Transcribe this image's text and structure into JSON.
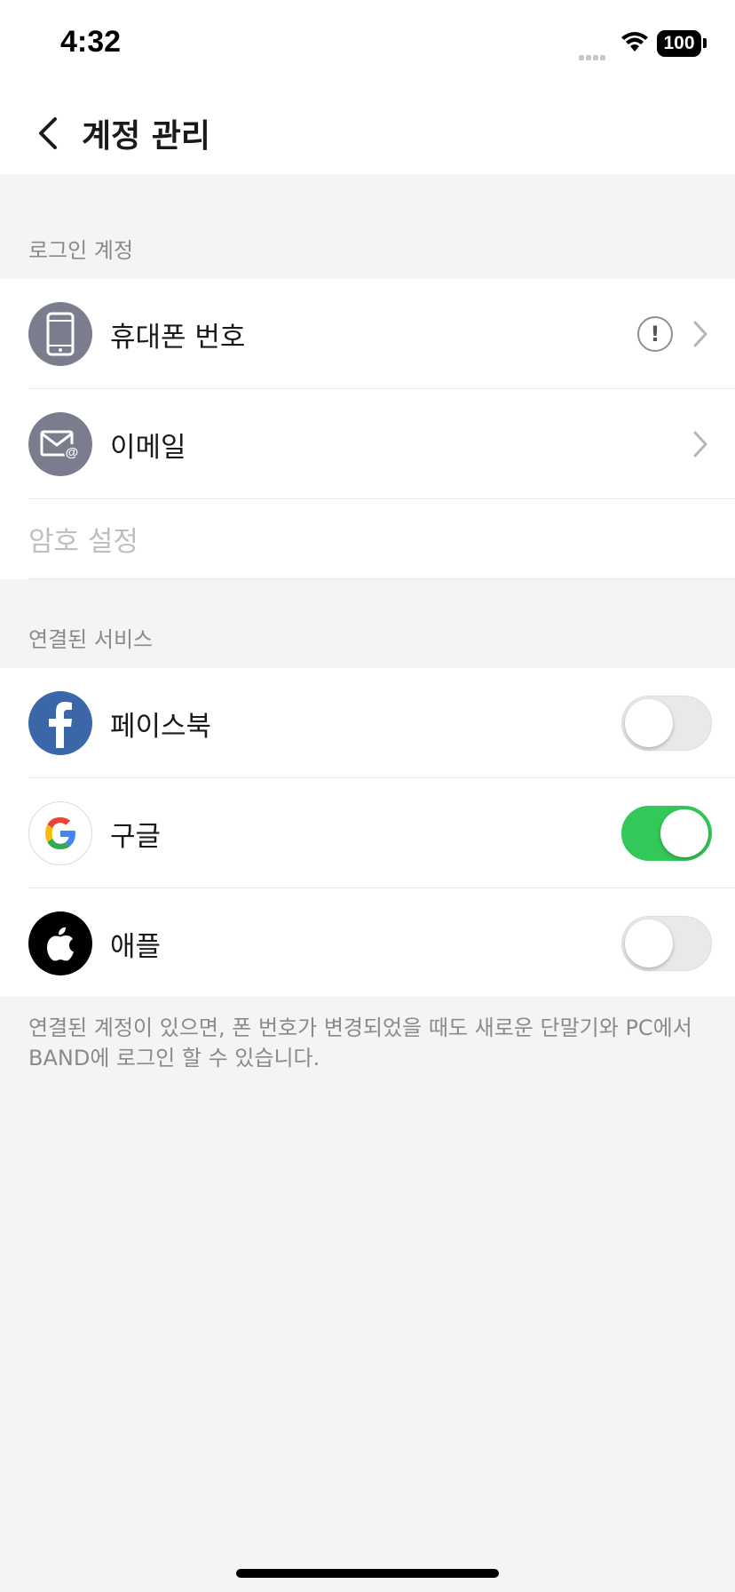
{
  "status_bar": {
    "time": "4:32",
    "battery": "100"
  },
  "nav": {
    "title": "계정 관리"
  },
  "login_section": {
    "header": "로그인 계정",
    "items": [
      {
        "label": "휴대폰 번호",
        "icon": "phone-icon",
        "warning": "!"
      },
      {
        "label": "이메일",
        "icon": "email-icon"
      }
    ],
    "password_label": "암호 설정"
  },
  "linked_section": {
    "header": "연결된 서비스",
    "items": [
      {
        "label": "페이스북",
        "icon": "facebook-icon",
        "enabled": false
      },
      {
        "label": "구글",
        "icon": "google-icon",
        "enabled": true
      },
      {
        "label": "애플",
        "icon": "apple-icon",
        "enabled": false
      }
    ]
  },
  "footer_note": "연결된 계정이 있으면, 폰 번호가 변경되었을 때도 새로운 단말기와 PC에서 BAND에 로그인 할 수 있습니다.",
  "colors": {
    "toggle_on": "#34c759",
    "icon_gray": "#7b7c8e",
    "facebook": "#3b66a8"
  }
}
